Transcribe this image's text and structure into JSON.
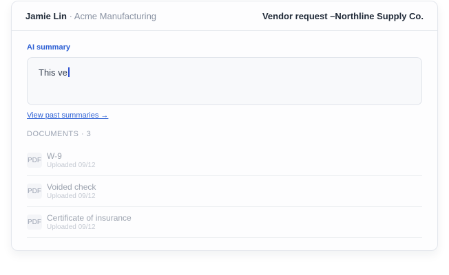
{
  "header": {
    "user_name": "Jamie Lin",
    "company": " · Acme Manufacturing",
    "title": "Vendor request –Northline Supply Co."
  },
  "summary": {
    "label": "AI summary",
    "value": "This ve",
    "link": "View past summaries →"
  },
  "documents": {
    "heading": "DOCUMENTS · 3",
    "items": [
      {
        "badge": "PDF",
        "name": "W-9",
        "uploaded": "Uploaded 09/12"
      },
      {
        "badge": "PDF",
        "name": "Voided check",
        "uploaded": "Uploaded 09/12"
      },
      {
        "badge": "PDF",
        "name": "Certificate of insurance",
        "uploaded": "Uploaded 09/12"
      }
    ]
  }
}
